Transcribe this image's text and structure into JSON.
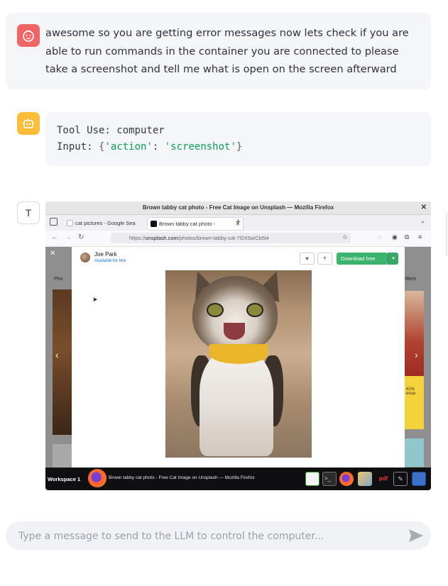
{
  "chat": {
    "user_message": "awesome so you are getting error messages now lets check if you are able to run commands in the container you are connected to please take a screenshot and tell me what is open on the screen afterward",
    "assistant": {
      "tool_use_label": "Tool Use:",
      "tool_name": "computer",
      "input_label": "Input:",
      "input_key": "'action'",
      "input_value": "'screenshot'"
    },
    "tool_avatar_letter": "T"
  },
  "screenshot": {
    "window_title": "Brown tabby cat photo - Free Cat Image on Unsplash — Mozilla Firefox",
    "tabs": [
      {
        "label": "cat pictures - Google Sea",
        "active": false
      },
      {
        "label": "Brown tabby cat photo -",
        "active": true
      }
    ],
    "url_prefix": "https://",
    "url_host": "unsplash.com",
    "url_path": "/photos/brown-tabby-cat-7GX5aICb5i4",
    "side_left_text": "Pho",
    "side_right_text": "Filters",
    "right_promo": "41%\nenue",
    "photographer": "Joe Park",
    "hire_status": "Available for hire",
    "download_label": "Download free",
    "taskbar": {
      "workspace": "Workspace 1",
      "window_title": "Brown tabby cat photo - Free Cat Image on Unsplash — Mozilla Firefox",
      "pdf_label": "pdf"
    }
  },
  "input": {
    "placeholder": "Type a message to send to the LLM to control the computer..."
  },
  "colors": {
    "user_avatar": "#f06565",
    "bot_avatar": "#fbbc3a",
    "code_string": "#09a057",
    "download_button": "#3cb46e"
  }
}
